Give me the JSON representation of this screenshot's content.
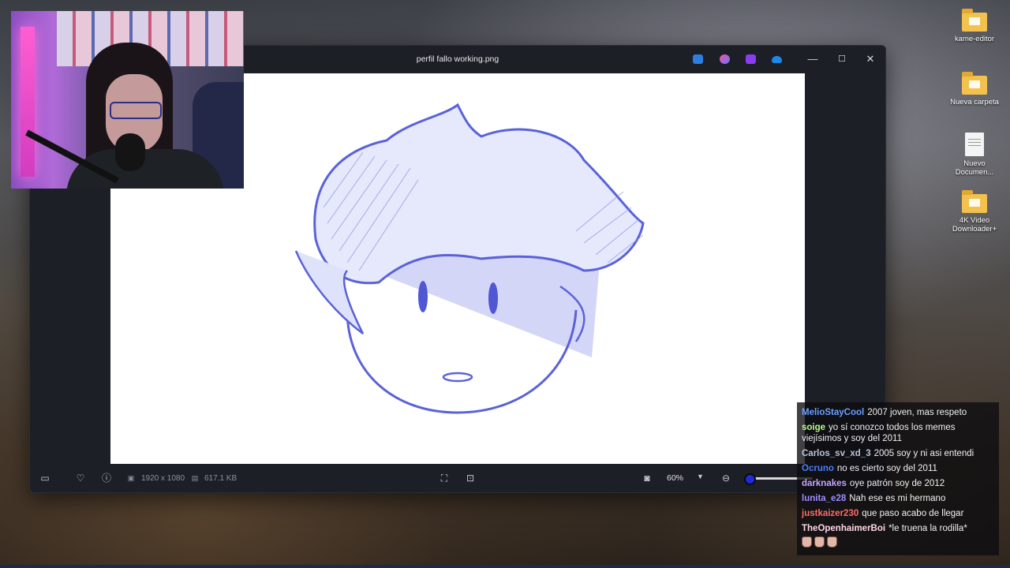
{
  "window": {
    "title": "perfil fallo working.png",
    "controls": {
      "minimize": "—",
      "maximize": "☐",
      "close": "✕"
    },
    "app_icons": [
      "edit-icon",
      "paint-icon",
      "clipchamp-icon",
      "onedrive-icon"
    ]
  },
  "bottombar": {
    "dimensions": "1920 x 1080",
    "file_size": "617.1 KB",
    "zoom": "60%"
  },
  "desktop": {
    "icons": [
      {
        "label": "kame-editor",
        "type": "folder"
      },
      {
        "label": "Nueva carpeta",
        "type": "folder"
      },
      {
        "label": "Nuevo Documen...",
        "type": "document"
      },
      {
        "label": "4K Video Downloader+",
        "type": "folder"
      }
    ]
  },
  "chat": {
    "messages": [
      {
        "user": "MelioStayCool",
        "color": "#6aa0ff",
        "text": "2007 joven, mas respeto"
      },
      {
        "user": "soige",
        "color": "#b7ff8a",
        "text": "yo sí conozco todos los memes viejísimos y soy del 2011"
      },
      {
        "user": "Carlos_sv_xd_3",
        "color": "#b9c4d8",
        "text": "2005 soy y ni asi entendi"
      },
      {
        "user": "Ocruno",
        "color": "#4a7dff",
        "text": "no es cierto soy del 2011"
      },
      {
        "user": "darknakes",
        "color": "#c9a3ff",
        "text": "oye patrón soy de 2012"
      },
      {
        "user": "lunita_e28",
        "color": "#9d8cff",
        "text": "Nah ese es mi hermano"
      },
      {
        "user": "justkaizer230",
        "color": "#ff6b6b",
        "text": "que paso acabo de llegar"
      },
      {
        "user": "TheOpenhaimerBoi",
        "color": "#ffd7e6",
        "text": "*le truena la rodilla*"
      }
    ]
  }
}
